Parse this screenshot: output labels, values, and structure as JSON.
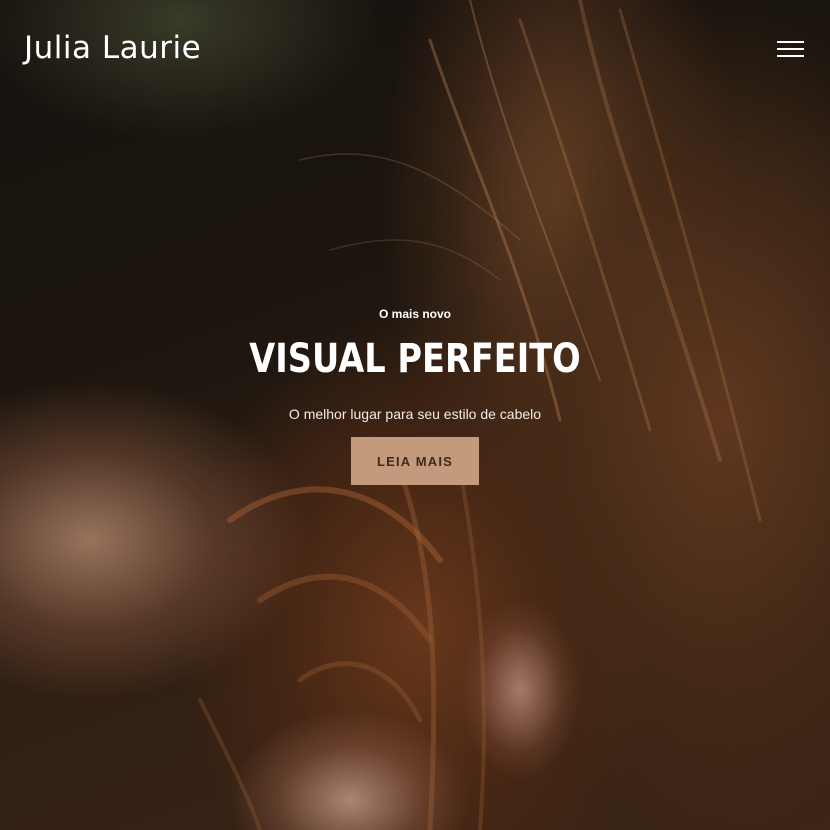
{
  "header": {
    "brand": "Julia Laurie",
    "menu_icon": "hamburger-menu-icon"
  },
  "hero": {
    "eyebrow": "O mais novo",
    "headline": "VISUAL PERFEITO",
    "subtitle": "O melhor lugar para seu estilo de cabelo",
    "cta_label": "LEIA MAIS",
    "cta_color": "#c49a7c",
    "background_image": "close-up of hands braiding auburn hair"
  }
}
